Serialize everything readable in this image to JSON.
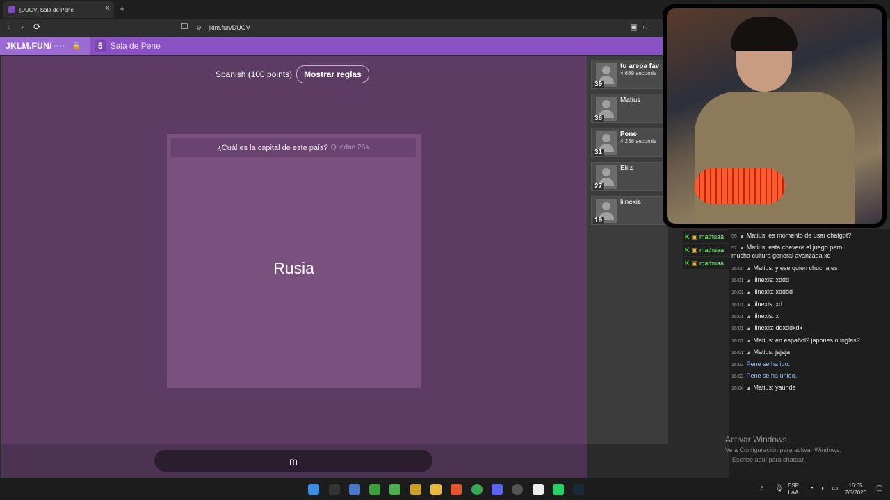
{
  "browser": {
    "tab_title": "[DUGV] Sala de Pene",
    "tab_close": "×",
    "new_tab": "+",
    "back": "‹",
    "forward": "›",
    "reload": "⟳",
    "bookmark": "☐",
    "url": "jklm.fun/DUGV"
  },
  "site": {
    "brand": "JKLM.FUN/",
    "brand_hidden": "····",
    "lock": "🔒",
    "room_count": "5",
    "room_name": "Sala de Pene"
  },
  "game": {
    "mode": "Spanish (100 points)",
    "rules_button": "Mostrar reglas",
    "question": "¿Cuál es la capital de este país?",
    "timer": "Quedan 25s.",
    "answer": "Rusia",
    "input_value": "m"
  },
  "players": [
    {
      "score": "39",
      "name": "tu arepa fav",
      "time": "4.689 seconds",
      "bold": true
    },
    {
      "score": "36",
      "name": "Matius",
      "time": "",
      "bold": false
    },
    {
      "score": "31",
      "name": "Pene",
      "time": "4.238 seconds",
      "bold": true
    },
    {
      "score": "27",
      "name": "Eliiz",
      "time": "",
      "bold": false
    },
    {
      "score": "19",
      "name": "lilnexis",
      "time": "",
      "bold": false
    }
  ],
  "viewers": [
    {
      "name": "mathuaa"
    },
    {
      "name": "mathuaa"
    },
    {
      "name": "mathuaa"
    }
  ],
  "chat": [
    {
      "time": "56",
      "text": "Matius: es momento de usar chatgpt?"
    },
    {
      "time": "57",
      "text": "Matius: esta chevere el juego pero"
    },
    {
      "time": "",
      "text": "mucha cultura general avanzada xd"
    },
    {
      "time": "16:00",
      "text": "Matius: y ese quien chucha es"
    },
    {
      "time": "16:01",
      "text": "lilnexis: xddd"
    },
    {
      "time": "16:01",
      "text": "lilnexis: xdddd"
    },
    {
      "time": "16:01",
      "text": "lilnexis: xd"
    },
    {
      "time": "16:01",
      "text": "lilnexis: x"
    },
    {
      "time": "16:01",
      "text": "lilnexis: ddxddxdx"
    },
    {
      "time": "16:01",
      "text": "Matius: en español? japones o ingles?"
    },
    {
      "time": "16:01",
      "text": "Matius: jajaja"
    },
    {
      "time": "16:03",
      "text": "Pene se ha ido."
    },
    {
      "time": "16:03",
      "text": "Pene se ha unido."
    },
    {
      "time": "16:04",
      "text": "Matius: yaunde"
    }
  ],
  "chat_placeholder": "Escribe aquí para chatear.",
  "watermark": {
    "title": "Activar Windows",
    "subtitle": "Ve a Configuración para activar Windows."
  },
  "taskbar": {
    "lang_top": "ESP",
    "lang_bottom": "LAA",
    "time": "16:05",
    "date": "7/8/2026"
  }
}
